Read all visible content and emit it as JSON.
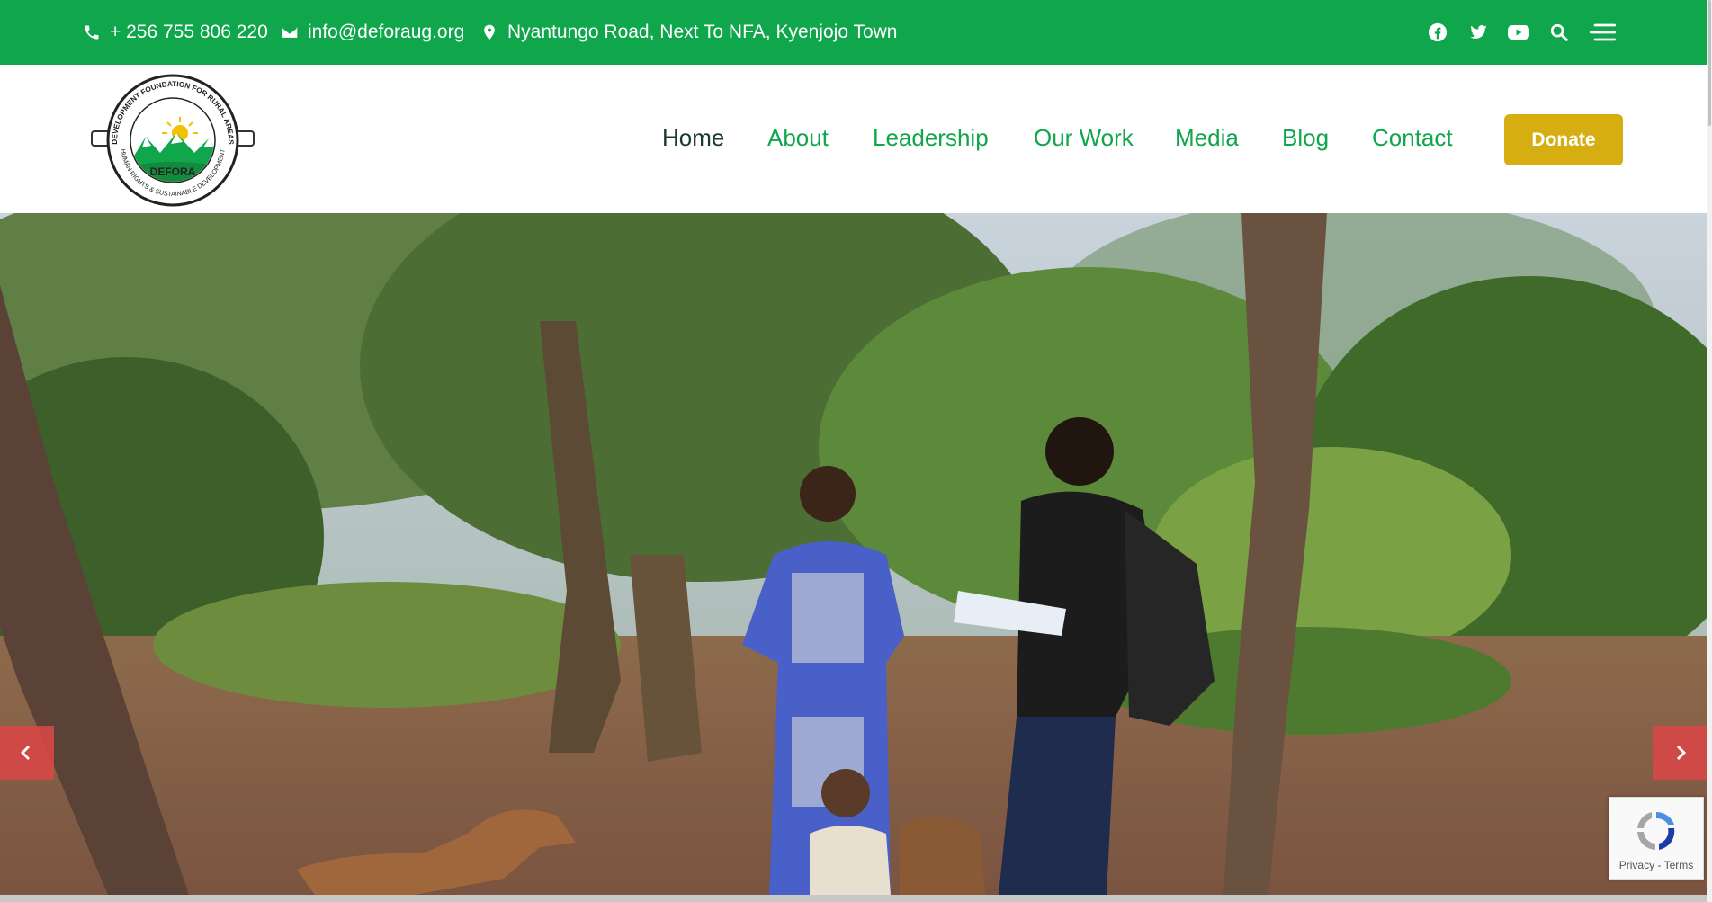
{
  "topbar": {
    "phone": "+ 256 755 806 220",
    "email": "info@deforaug.org",
    "address": "Nyantungo Road, Next To NFA, Kyenjojo Town",
    "social_icons": [
      "facebook-icon",
      "twitter-icon",
      "youtube-icon",
      "search-icon",
      "menu-icon"
    ],
    "background_color": "#0fa64c"
  },
  "logo": {
    "top_text": "DEVELOPMENT FOUNDATION FOR RURAL AREAS",
    "name": "DEFORA",
    "bottom_text": "HUMAN RIGHTS & SUSTAINABLE DEVELOPMENT"
  },
  "nav": {
    "items": [
      "Home",
      "About",
      "Leadership",
      "Our Work",
      "Media",
      "Blog",
      "Contact"
    ],
    "active": "Home",
    "donate_label": "Donate",
    "link_color": "#0fa64c",
    "donate_color": "#d6ae11"
  },
  "hero": {
    "prev_icon": "chevron-left-icon",
    "next_icon": "chevron-right-icon"
  },
  "recaptcha": {
    "privacy": "Privacy",
    "separator": " - ",
    "terms": "Terms"
  }
}
